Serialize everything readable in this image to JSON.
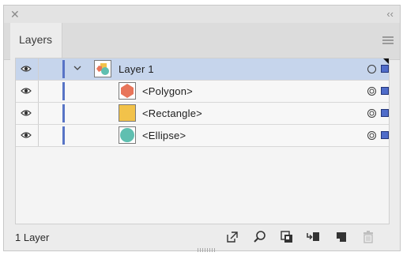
{
  "panel": {
    "close_glyph": "✕",
    "collapse_glyph": "‹‹",
    "tab_label": "Layers",
    "menu_icon": "hamburger-icon"
  },
  "colors": {
    "selected_row": "#c6d5ec",
    "layer_color": "#5874c6",
    "polygon_fill": "#e8755a",
    "rectangle_fill": "#f2c24a",
    "ellipse_fill": "#5fbfb0"
  },
  "layers": [
    {
      "label": "Layer 1",
      "expanded": true,
      "selected": true,
      "visible": true,
      "thumb_icon": "layer-thumbnail"
    },
    {
      "label": "<Polygon>",
      "visible": true,
      "thumb_icon": "polygon-thumbnail"
    },
    {
      "label": "<Rectangle>",
      "visible": true,
      "thumb_icon": "rectangle-thumbnail"
    },
    {
      "label": "<Ellipse>",
      "visible": true,
      "thumb_icon": "ellipse-thumbnail"
    }
  ],
  "footer": {
    "layer_count": "1 Layer",
    "icons": [
      "export-icon",
      "locate-object-icon",
      "make-clipping-mask-icon",
      "create-sublayer-icon",
      "new-layer-icon",
      "delete-icon"
    ]
  }
}
